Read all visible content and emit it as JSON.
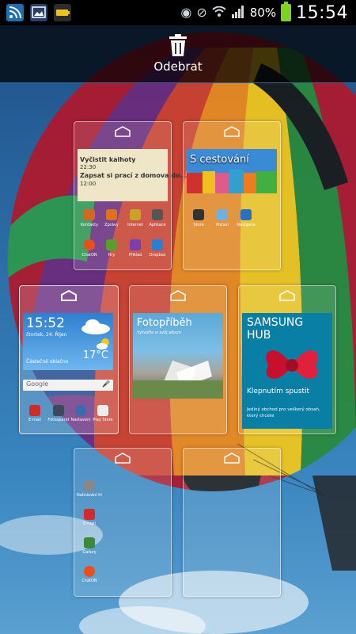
{
  "status_bar": {
    "battery": "80%",
    "time": "15:54",
    "icons": [
      "rss-icon",
      "gallery-icon",
      "battery-app-icon",
      "eye-icon",
      "mute-icon",
      "wifi-icon",
      "signal-icon"
    ]
  },
  "remove_bar": {
    "label": "Odebrat",
    "icon": "trash-icon"
  },
  "panels": {
    "p1": {
      "memo": {
        "line1": "Vyčistit kalhoty",
        "time1": "22:30",
        "line2": "Zapsat si prací z domova do...",
        "time2": "12:00"
      },
      "apps_row1": [
        "Kontakty",
        "Zprávy",
        "Internet",
        "Aplikace"
      ],
      "apps_row2": [
        "ChatON",
        "Hry",
        "Příklad",
        "Dropbox"
      ]
    },
    "p2": {
      "travel_title": "S cestování",
      "apps": [
        "Store",
        "Počasí",
        "Navigace"
      ]
    },
    "p3": {
      "weather_time": "15:52",
      "weather_date": "čtvrtek, 24. Říjen",
      "weather_cond": "Částečně oblačno",
      "weather_temp": "17°C",
      "google": "Google",
      "apps": [
        "E-mail",
        "Fotoaparát",
        "Nastavení",
        "Play Store"
      ]
    },
    "p4": {
      "story_title": "Fotopříběh",
      "story_sub": "Vytvořte si svůj album"
    },
    "p5": {
      "hub_title1": "SAMSUNG",
      "hub_title2": "HUB",
      "hub_start": "Klepnutím spustit",
      "hub_desc1": "Jediný obchod pro veškerý obsah,",
      "hub_desc2": "který chcete"
    },
    "p6": {
      "apps": [
        "Nahrávání hlasu",
        "E-mail",
        "Galaxy",
        "ChatON"
      ]
    }
  },
  "colors": {
    "status_bg": "#000000",
    "battery": "#7ed321",
    "hub_bg": "#0a7fa6",
    "memo_bg": "#efe6c8"
  }
}
